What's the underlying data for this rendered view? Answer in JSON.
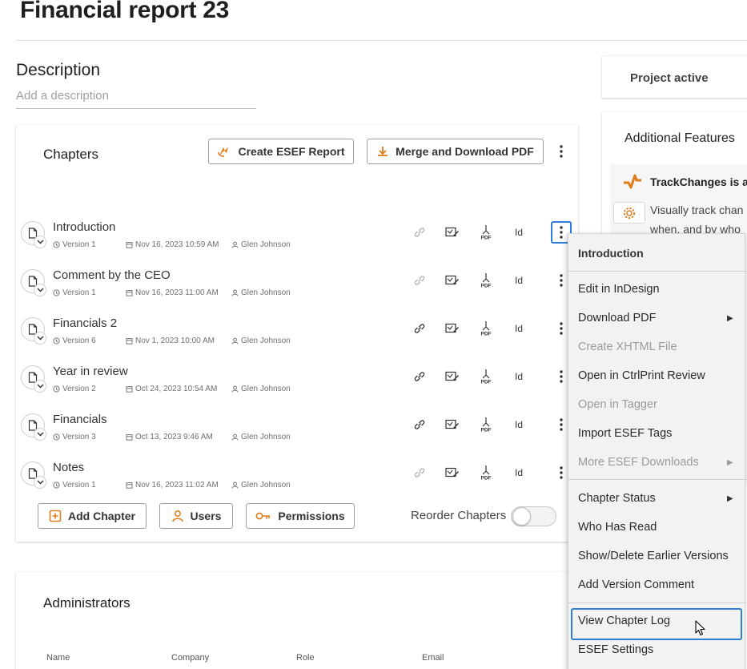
{
  "page": {
    "title": "Financial report 23"
  },
  "description": {
    "title": "Description",
    "placeholder": "Add a description"
  },
  "chapters": {
    "title": "Chapters",
    "create_esef_label": "Create ESEF Report",
    "merge_label": "Merge and Download PDF",
    "items": [
      {
        "name": "Introduction",
        "version": "Version 1",
        "date": "Nov 16, 2023 10:59 AM",
        "user": "Glen Johnson",
        "id_label": "Id"
      },
      {
        "name": "Comment by the CEO",
        "version": "Version 1",
        "date": "Nov 16, 2023 11:00 AM",
        "user": "Glen Johnson",
        "id_label": "Id"
      },
      {
        "name": "Financials 2",
        "version": "Version 6",
        "date": "Nov 1, 2023 10:00 AM",
        "user": "Glen Johnson",
        "id_label": "Id"
      },
      {
        "name": "Year in review",
        "version": "Version 2",
        "date": "Oct 24, 2023 10:54 AM",
        "user": "Glen Johnson",
        "id_label": "Id"
      },
      {
        "name": "Financials",
        "version": "Version 3",
        "date": "Oct 13, 2023 9:46 AM",
        "user": "Glen Johnson",
        "id_label": "Id"
      },
      {
        "name": "Notes",
        "version": "Version 1",
        "date": "Nov 16, 2023 11:02 AM",
        "user": "Glen Johnson",
        "id_label": "Id"
      }
    ],
    "add_chapter_label": "Add Chapter",
    "users_label": "Users",
    "permissions_label": "Permissions",
    "reorder_label": "Reorder Chapters"
  },
  "administrators": {
    "title": "Administrators",
    "columns": [
      "Name",
      "Company",
      "Role",
      "Email"
    ]
  },
  "sidebar": {
    "project_status": "Project active",
    "features_title": "Additional Features",
    "trackchanges_title": "TrackChanges is a",
    "trackchanges_desc_1": "Visually track chan",
    "trackchanges_desc_2": "when, and by who"
  },
  "context_menu": {
    "header": "Introduction",
    "items": [
      {
        "label": "Edit in InDesign"
      },
      {
        "label": "Download PDF",
        "arrow": "▶"
      },
      {
        "label": "Create XHTML File"
      },
      {
        "label": "Open in CtrlPrint Review"
      },
      {
        "label": "Open in Tagger"
      },
      {
        "label": "Import ESEF Tags"
      },
      {
        "label": "More ESEF Downloads",
        "arrow": "▶"
      },
      {
        "label": "Chapter Status",
        "arrow": "▶"
      },
      {
        "label": "Who Has Read"
      },
      {
        "label": "Show/Delete Earlier Versions"
      },
      {
        "label": "Add Version Comment"
      },
      {
        "label": "View Chapter Log"
      },
      {
        "label": "ESEF Settings"
      }
    ]
  },
  "colors": {
    "accent_orange": "#e07b1a",
    "focus_blue": "#2f7fd8"
  }
}
